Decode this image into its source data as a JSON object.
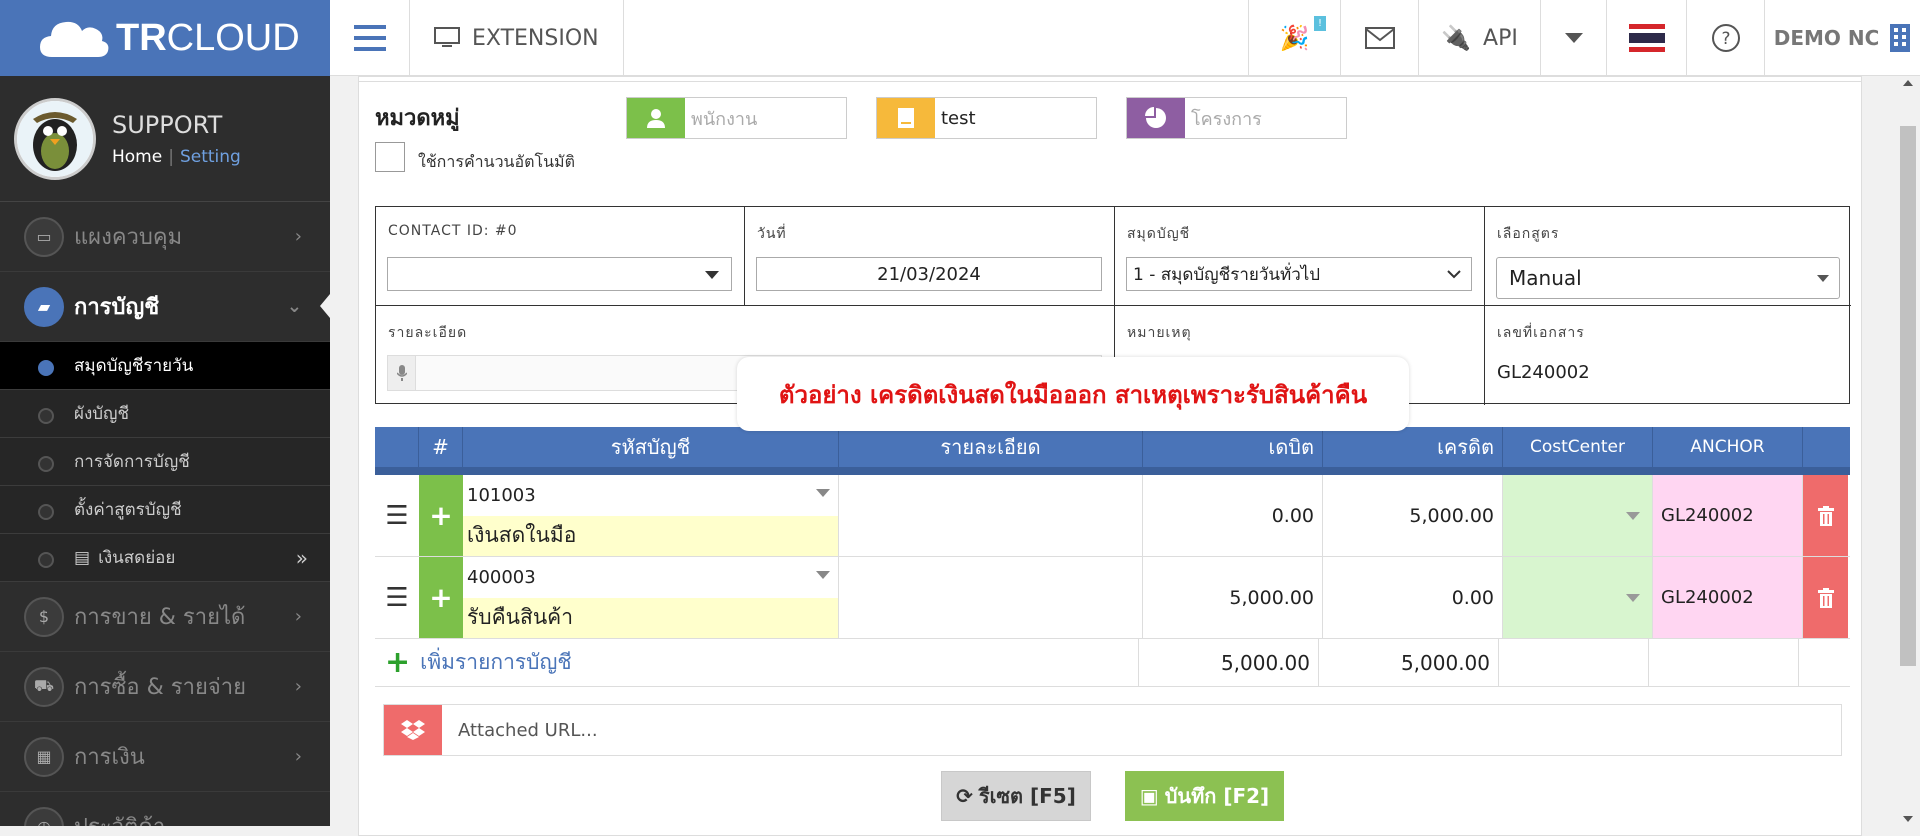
{
  "brand": {
    "logo_bold": "TR",
    "logo_thin": "CLOUD"
  },
  "topbar": {
    "extension_label": "EXTENSION",
    "badge": "!",
    "api_label": "API",
    "company": "DEMO NC"
  },
  "profile": {
    "name": "SUPPORT",
    "home": "Home",
    "sep": "|",
    "setting": "Setting"
  },
  "sidebar": {
    "items": [
      {
        "label": "แผงควบคุม",
        "icon": "monitor-icon"
      },
      {
        "label": "การบัญชี",
        "icon": "book-icon"
      },
      {
        "label": "การขาย & รายได้",
        "icon": "dollar-icon"
      },
      {
        "label": "การซื้อ & รายจ่าย",
        "icon": "cart-icon"
      },
      {
        "label": "การเงิน",
        "icon": "calendar-icon"
      },
      {
        "label": "ประวัติค้า",
        "icon": "history-icon"
      }
    ],
    "subitems": [
      {
        "label": "สมุดบัญชีรายวัน"
      },
      {
        "label": "ผังบัญชี"
      },
      {
        "label": "การจัดการบัญชี"
      },
      {
        "label": "ตั้งค่าสูตรบัญชี"
      },
      {
        "label": "เงินสดย่อย"
      }
    ]
  },
  "category": {
    "title": "หมวดหมู่",
    "auto_calc_label": "ใช้การคำนวนอัตโนมัติ",
    "employee_placeholder": "พนักงาน",
    "doc_value": "test",
    "project_placeholder": "โครงการ"
  },
  "form": {
    "contact_label": "CONTACT ID: #0",
    "date_label": "วันที่",
    "date_value": "21/03/2024",
    "book_label": "สมุดบัญชี",
    "book_value": "1 - สมุดบัญชีรายวันทั่วไป",
    "formula_label": "เลือกสูตร",
    "formula_value": "Manual",
    "detail_label": "รายละเอียด",
    "note_label": "หมายเหตุ",
    "docno_label": "เลขที่เอกสาร",
    "docno_value": "GL240002"
  },
  "tooltip": "ตัวอย่าง เครดิตเงินสดในมือออก สาเหตุเพราะรับสินค้าคืน",
  "table": {
    "headers": {
      "num": "#",
      "account": "รหัสบัญชี",
      "detail": "รายละเอียด",
      "debit": "เดบิต",
      "credit": "เครดิต",
      "cost": "CostCenter",
      "anchor": "ANCHOR"
    },
    "rows": [
      {
        "code": "101003",
        "name": "เงินสดในมือ",
        "debit": "0.00",
        "credit": "5,000.00",
        "anchor": "GL240002"
      },
      {
        "code": "400003",
        "name": "รับคืนสินค้า",
        "debit": "5,000.00",
        "credit": "0.00",
        "anchor": "GL240002"
      }
    ],
    "add_label": "เพิ่มรายการบัญชี",
    "total_debit": "5,000.00",
    "total_credit": "5,000.00"
  },
  "attach_placeholder": "Attached URL...",
  "buttons": {
    "reset": "รีเซต [F5]",
    "save": "บันทึก [F2]"
  },
  "colors": {
    "primary": "#4a74b8",
    "sidebar": "#2d2d2d",
    "green": "#7cc04a",
    "red": "#ef6b6b",
    "yellow": "#f6b93b",
    "purple": "#8e5ea2"
  }
}
